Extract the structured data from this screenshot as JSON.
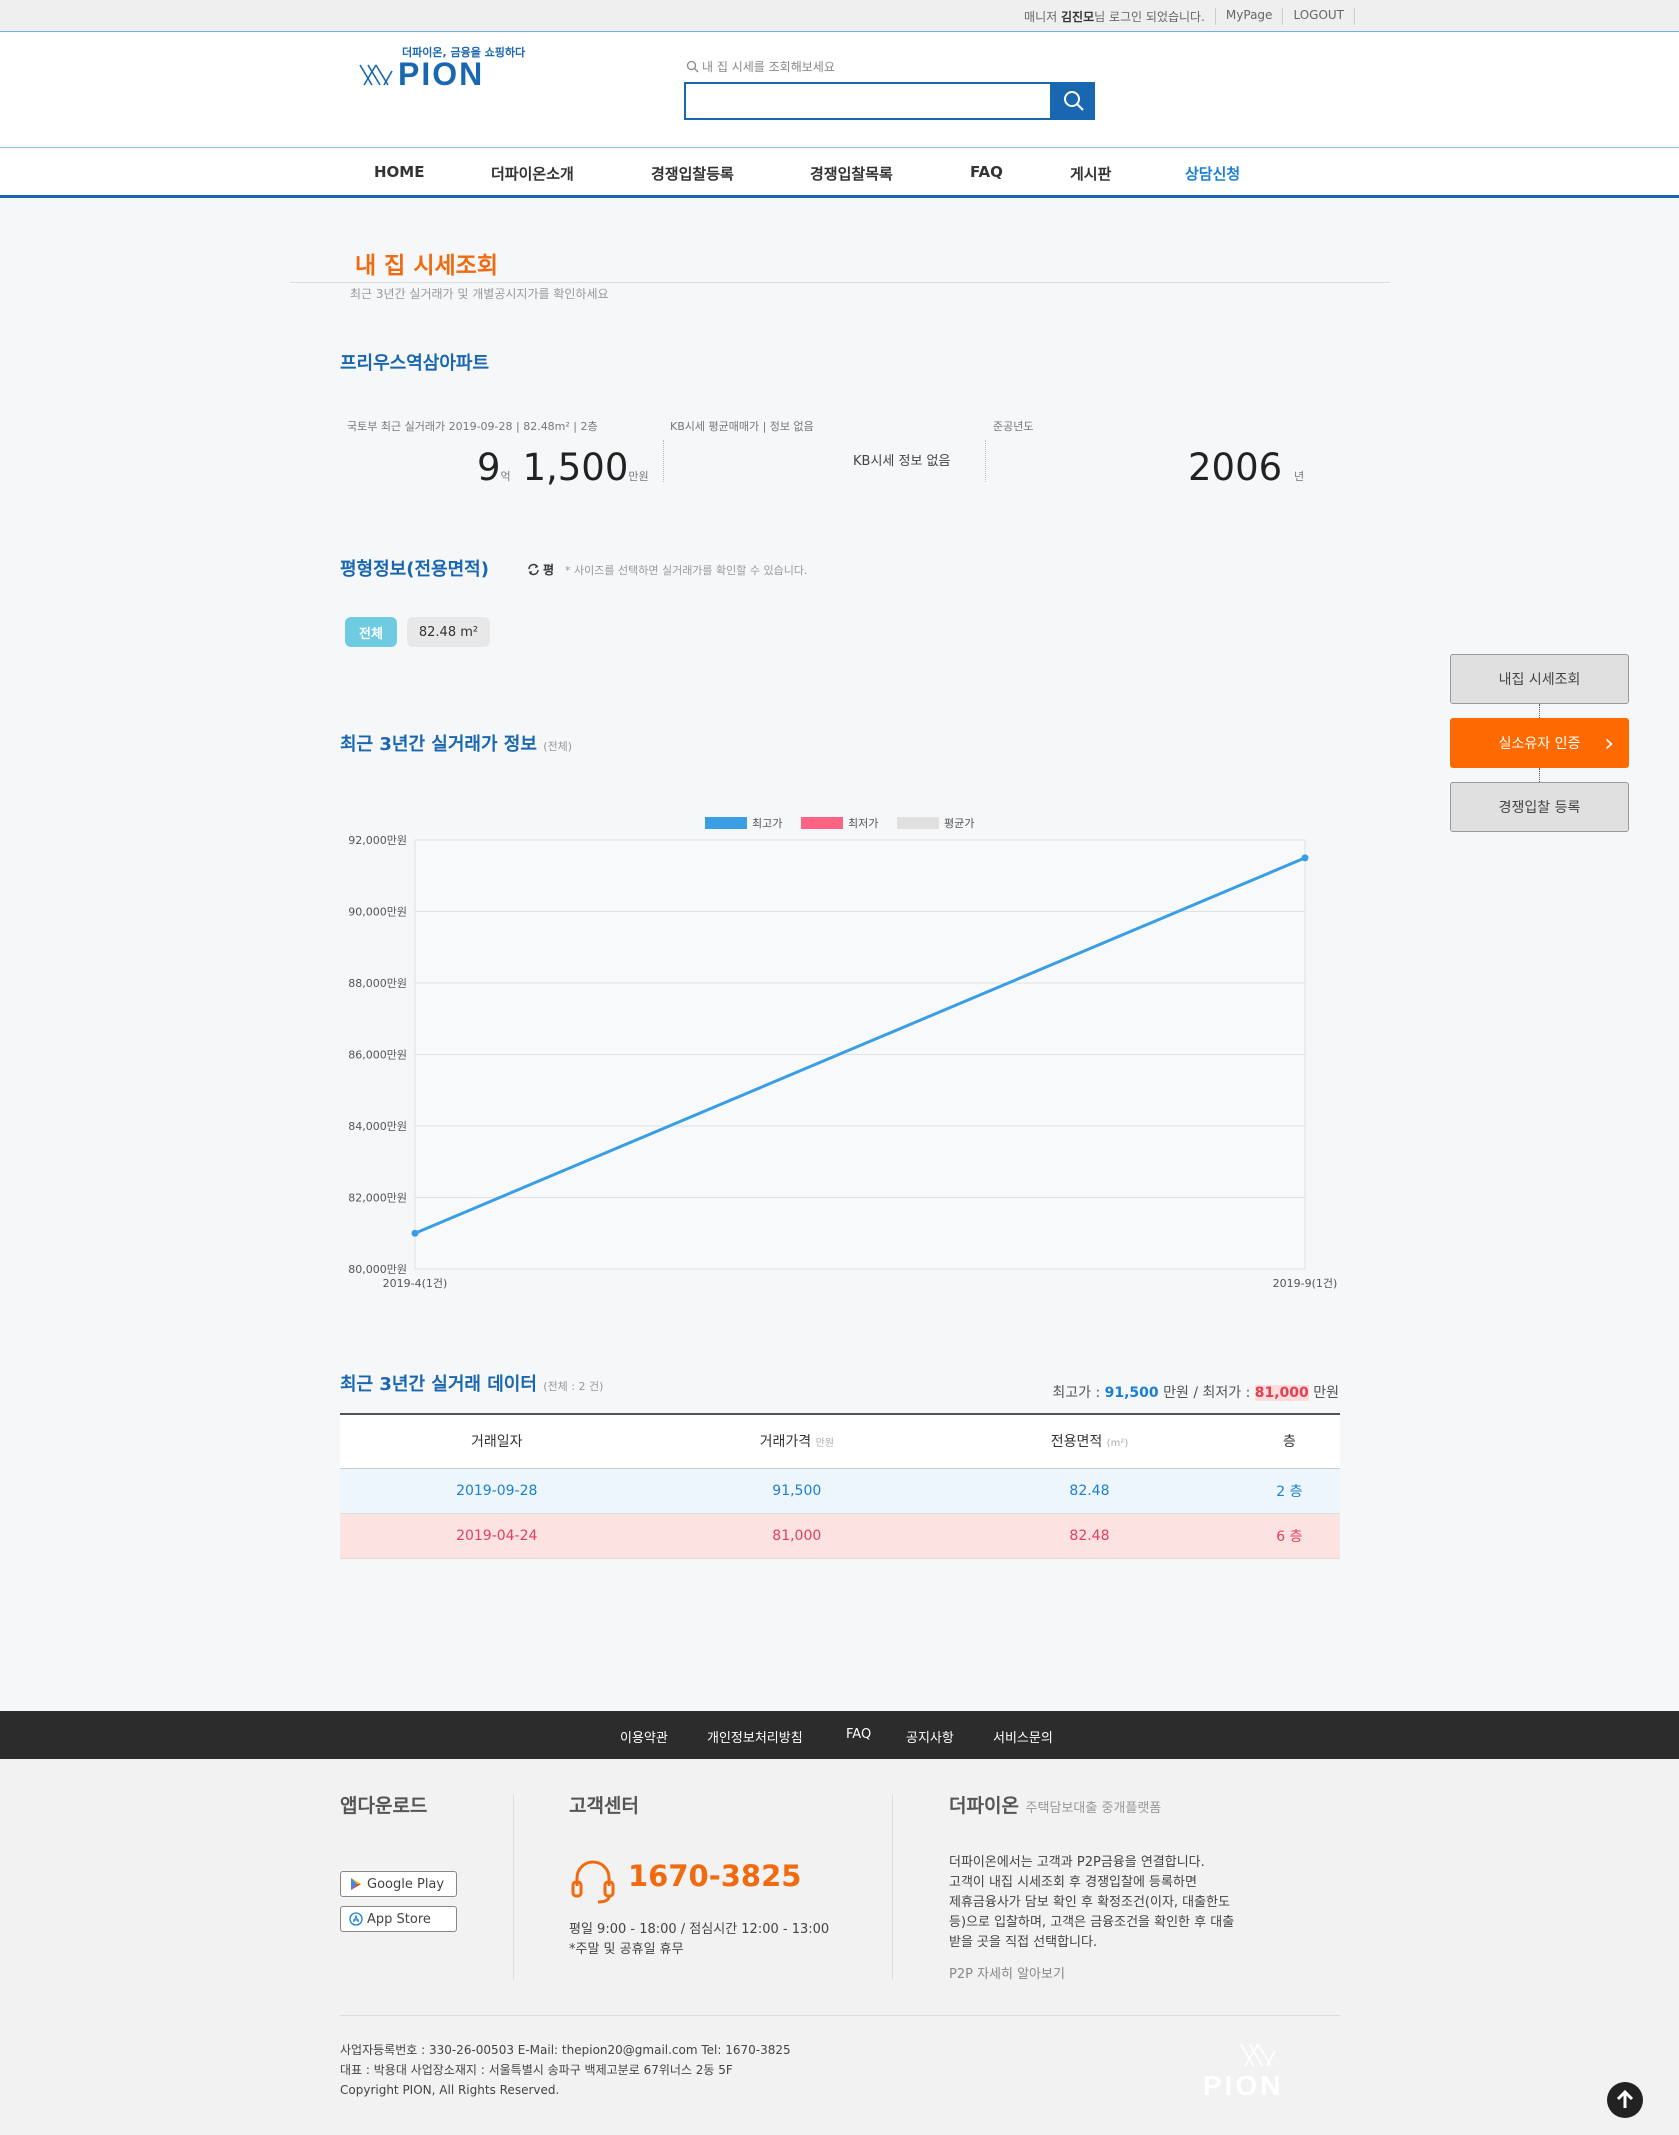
{
  "topbar": {
    "greeting_prefix": "매니저",
    "user": "김진모",
    "greeting_suffix": "님 로그인 되었습니다.",
    "mypage": "MyPage",
    "logout": "LOGOUT"
  },
  "header": {
    "logo_tagline": "더파이온, 금융을 쇼핑하다",
    "logo_word": "PION",
    "search_placeholder": "내 집 시세를 조회해보세요"
  },
  "nav": [
    "HOME",
    "더파이온소개",
    "경쟁입찰등록",
    "경쟁입찰목록",
    "FAQ",
    "게시판",
    "상담신청"
  ],
  "page": {
    "title": "내 집 시세조회",
    "subtitle": "최근 3년간 실거래가 및 개별공시지가를 확인하세요"
  },
  "apartment": {
    "name": "프리우스역삼아파트",
    "trade_label": "국토부 최근 실거래가 2019-09-28 | 82.48m² | 2층",
    "trade_eok": "9",
    "eok_unit": "억",
    "trade_man": "1,500",
    "man_unit": "만원",
    "kb_label": "KB시세 평균매매가 | 정보 없음",
    "kb_value": "KB시세 정보 없음",
    "year_label": "준공년도",
    "year_value": "2006",
    "year_unit": "년"
  },
  "size_info": {
    "title": "평형정보(전용면적)",
    "toggle": "평",
    "note": "* 사이즈를 선택하면 실거래가를 확인할 수 있습니다.",
    "chip_all": "전체",
    "chip_size": "82.48 m²"
  },
  "side": {
    "btn1": "내집 시세조회",
    "btn2": "실소유자 인증",
    "btn3": "경쟁입찰 등록"
  },
  "chart_section": {
    "title": "최근 3년간 실거래가 정보",
    "tag": "(전체)"
  },
  "chart_data": {
    "type": "line",
    "x": [
      "2019-4(1건)",
      "2019-9(1건)"
    ],
    "series": [
      {
        "name": "최고가",
        "values": [
          81000,
          91500
        ],
        "color": "#3a9ee4"
      },
      {
        "name": "최저가",
        "values": [],
        "color": "#ff6384"
      },
      {
        "name": "평균가",
        "values": [],
        "color": "#e0e0e0"
      }
    ],
    "ylim": [
      80000,
      92000
    ],
    "yticks": [
      "80,000만원",
      "82,000만원",
      "84,000만원",
      "86,000만원",
      "88,000만원",
      "90,000만원",
      "92,000만원"
    ],
    "legend": "top-center",
    "grid": true
  },
  "table_section": {
    "title": "최근 3년간 실거래 데이터",
    "tag": "(전체 : 2 건)",
    "summary_max_label": "최고가 :",
    "summary_max": "91,500",
    "summary_min_label": "만원 / 최저가 :",
    "summary_min": "81,000",
    "summary_unit": "만원",
    "headers": [
      "거래일자",
      "거래가격",
      "전용면적",
      "층"
    ],
    "header_units": [
      "",
      "만원",
      "(m²)",
      ""
    ],
    "rows": [
      [
        "2019-09-28",
        "91,500",
        "82.48",
        "2 층"
      ],
      [
        "2019-04-24",
        "81,000",
        "82.48",
        "6 층"
      ]
    ]
  },
  "footer": {
    "links": [
      "이용약관",
      "개인정보처리방침",
      "FAQ",
      "공지사항",
      "서비스문의"
    ],
    "app_title": "앱다운로드",
    "google_play": "Google Play",
    "app_store": "App Store",
    "cs_title": "고객센터",
    "phone": "1670-3825",
    "hours": "평일 9:00 - 18:00 / 점심시간 12:00 - 13:00",
    "holiday": "*주말 및 공휴일 휴무",
    "about_title": "더파이온",
    "about_sub": "주택담보대출 중개플랫폼",
    "about_lines": [
      "더파이온에서는 고객과 P2P금융을 연결합니다.",
      "고객이 내집 시세조회 후 경쟁입찰에 등록하면",
      "제휴금융사가 담보 확인 후 확정조건(이자, 대출한도",
      "등)으로 입찰하며, 고객은 금융조건을 확인한 후 대출",
      "받을 곳을 직접 선택합니다."
    ],
    "about_link": "P2P 자세히 알아보기",
    "biz_line1": "사업자등록번호 : 330-26-00503 E-Mail: thepion20@gmail.com Tel: 1670-3825",
    "biz_line2": "대표 : 박용대 사업장소재지 : 서울특별시 송파구 백제고분로 67위너스 2동 5F",
    "copyright": "Copyright PION, All Rights Reserved.",
    "bottom_logo": "PION"
  }
}
